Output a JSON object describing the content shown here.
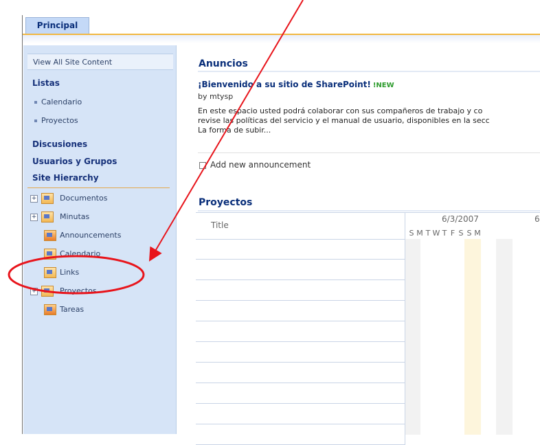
{
  "tabs": {
    "principal": "Principal"
  },
  "quick_launch": {
    "view_all": "View All Site Content",
    "listas": "Listas",
    "listas_items": [
      "Calendario",
      "Proyectos"
    ],
    "discusiones": "Discusiones",
    "usuarios": "Usuarios y Grupos",
    "site_hierarchy": "Site Hierarchy",
    "tree": [
      "Documentos",
      "Minutas",
      "Announcements",
      "Calendario",
      "Links",
      "Proyectos",
      "Tareas"
    ]
  },
  "announcements": {
    "heading": "Anuncios",
    "title": "¡Bienvenido a su sitio de SharePoint!",
    "new_badge": "NEW",
    "byline": "by mtysp",
    "body_line1": "En este espacio usted podrá colaborar con sus compañeros de trabajo y co",
    "body_line2": "revise las políticas del servicio y el manual de usuario, disponibles en la secc",
    "body_line3": "La forma de subir...",
    "add_link": "Add new announcement"
  },
  "proyectos": {
    "heading": "Proyectos",
    "title_col": "Title",
    "date1": "6/3/2007",
    "date2": "6",
    "days": [
      "S",
      "M",
      "T",
      "W",
      "T",
      "F",
      "S",
      "S",
      "M"
    ]
  },
  "colors": {
    "accent": "#f2b740",
    "nav_bg": "#d6e4f7",
    "annotation": "#e8141b",
    "heading": "#0a2f7a"
  }
}
